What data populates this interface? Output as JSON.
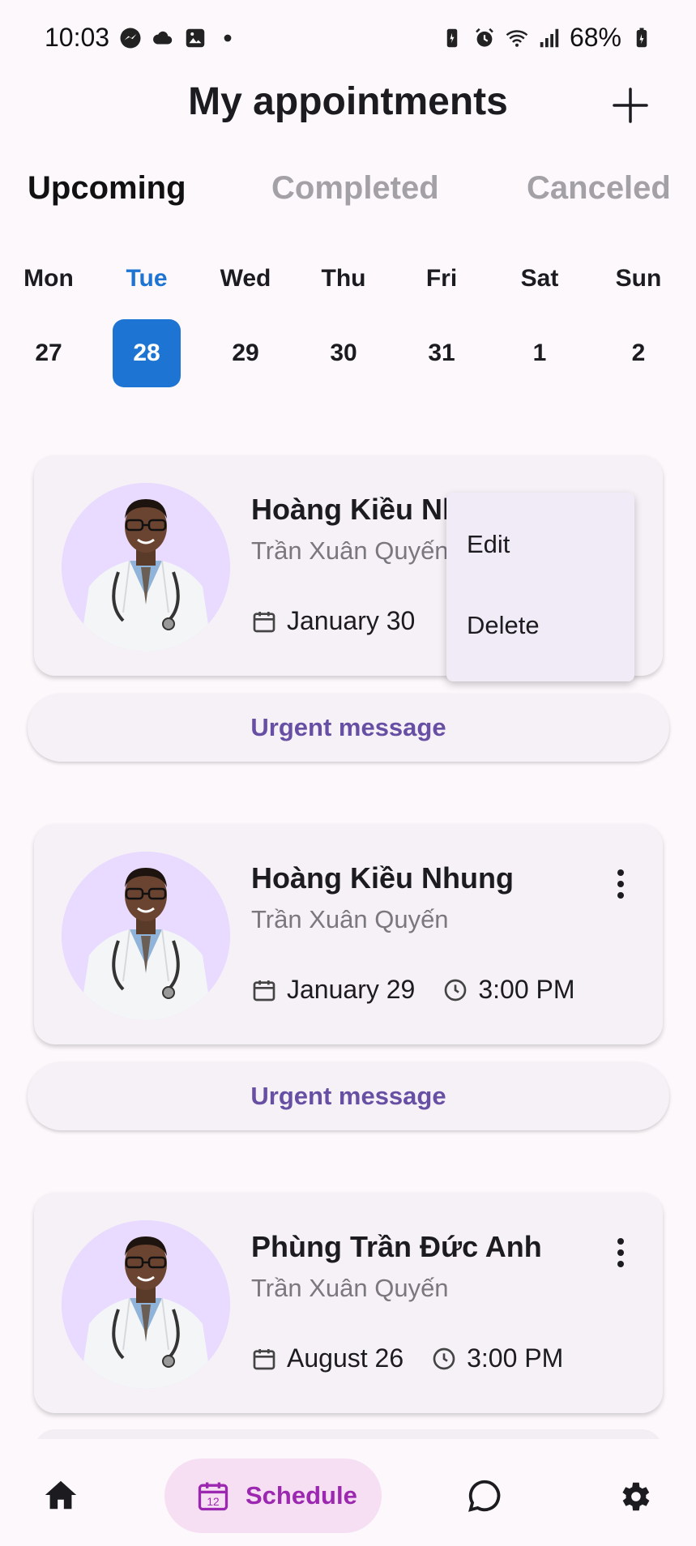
{
  "status_bar": {
    "time": "10:03",
    "battery": "68%",
    "left_icons": [
      "messenger-icon",
      "cloud-icon",
      "gallery-icon",
      "dot-icon"
    ],
    "right_icons": [
      "battery-saver-icon",
      "alarm-icon",
      "wifi-icon",
      "signal-icon",
      "battery-icon"
    ]
  },
  "header": {
    "title": "My appointments",
    "add_icon": "plus-icon"
  },
  "tabs": [
    {
      "label": "Upcoming",
      "active": true
    },
    {
      "label": "Completed",
      "active": false
    },
    {
      "label": "Canceled",
      "active": false
    }
  ],
  "week": [
    {
      "day": "Mon",
      "date": "27"
    },
    {
      "day": "Tue",
      "date": "28",
      "selected": true
    },
    {
      "day": "Wed",
      "date": "29"
    },
    {
      "day": "Thu",
      "date": "30"
    },
    {
      "day": "Fri",
      "date": "31"
    },
    {
      "day": "Sat",
      "date": "1"
    },
    {
      "day": "Sun",
      "date": "2"
    }
  ],
  "appointments": [
    {
      "doctor": "Hoàng Kiều Nhung",
      "patient": "Trần Xuân Quyến",
      "date": "January 30",
      "time": "",
      "urgent_label": "Urgent message"
    },
    {
      "doctor": "Hoàng Kiều Nhung",
      "patient": "Trần Xuân Quyến",
      "date": "January 29",
      "time": "3:00 PM",
      "urgent_label": "Urgent message"
    },
    {
      "doctor": "Phùng Trần Đức Anh",
      "patient": "Trần Xuân Quyến",
      "date": "August 26",
      "time": "3:00 PM"
    }
  ],
  "popup_menu": {
    "items": [
      "Edit",
      "Delete"
    ]
  },
  "bottom_nav": {
    "items": [
      {
        "icon": "home-icon",
        "label": ""
      },
      {
        "icon": "calendar-icon",
        "label": "Schedule",
        "active": true
      },
      {
        "icon": "chat-icon",
        "label": ""
      },
      {
        "icon": "gear-icon",
        "label": ""
      }
    ]
  },
  "colors": {
    "accent_blue": "#1E74D2",
    "accent_purple": "#6750A4",
    "schedule_active": "#9C27B0",
    "avatar_bg": "#E8DBFF"
  }
}
